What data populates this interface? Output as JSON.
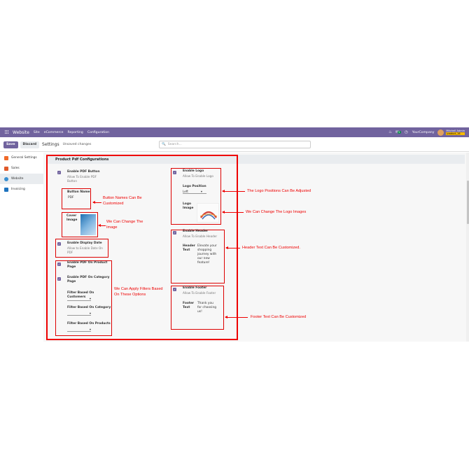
{
  "topbar": {
    "brand": "Website",
    "menu": [
      "Site",
      "eCommerce",
      "Reporting",
      "Configuration"
    ],
    "company": "YourCompany",
    "user_name": "Mitchell Admin",
    "user_db": "product_16",
    "badge_count": "5"
  },
  "control": {
    "save_label": "Save",
    "discard_label": "Discard",
    "breadcrumb": "Settings",
    "unsaved": "Unsaved changes",
    "search_placeholder": "Search..."
  },
  "sidebar": {
    "items": [
      {
        "label": "General Settings",
        "color": "#f06a29"
      },
      {
        "label": "Sales",
        "color": "#e05a2b"
      },
      {
        "label": "Website",
        "color": "#3a8fd1"
      },
      {
        "label": "Invoicing",
        "color": "#1e73be"
      }
    ]
  },
  "section_title": "Product Pdf Configurations",
  "settings": {
    "pdf_button": {
      "label": "Enable PDF Button",
      "desc": "Allow To Enable PDF Button"
    },
    "button_name": {
      "label": "Button Name",
      "value": "PDF"
    },
    "cover_image": {
      "label": "Cover Image"
    },
    "display_date": {
      "label": "Enable Display Date",
      "desc": "Allow to Enable Date On PDF"
    },
    "pdf_product": {
      "label": "Enable PDF On Product Page"
    },
    "pdf_category": {
      "label": "Enable PDF On Category Page"
    },
    "filter_customers": {
      "label": "Filter Based On Customers"
    },
    "filter_category": {
      "label": "Filter Based On Category"
    },
    "filter_products": {
      "label": "Filter Based On Products"
    },
    "enable_logo": {
      "label": "Enable Logo",
      "desc": "Allow To Enable Logo"
    },
    "logo_position": {
      "label": "Logo Position",
      "value": "Left"
    },
    "logo_image": {
      "label": "Logo Image"
    },
    "enable_header": {
      "label": "Enable Header",
      "desc": "Allow To Enable Header"
    },
    "header_text": {
      "label": "Header Text",
      "value": "Elevate your shopping journey with our new feature!"
    },
    "enable_footer": {
      "label": "Enable Footer",
      "desc": "Allow To Enable Footer"
    },
    "footer_text": {
      "label": "Footer Text",
      "value": "Thank you for choosing us!"
    }
  },
  "notes": {
    "button_names": "Button Names Can Be Customized",
    "change_image": "We Can Change The Image",
    "filters": "We Can Apply Filters Based On These Options",
    "logo_positions": "The Logo Positions Can Be Adjusted",
    "logo_images": "We Can Change The  Logo Images",
    "header_text": "Header Text Can Be Customized.",
    "footer_text": "Footer Text Can Be Customized"
  },
  "colors": {
    "brand": "#71639e",
    "annotation": "#e00000"
  }
}
